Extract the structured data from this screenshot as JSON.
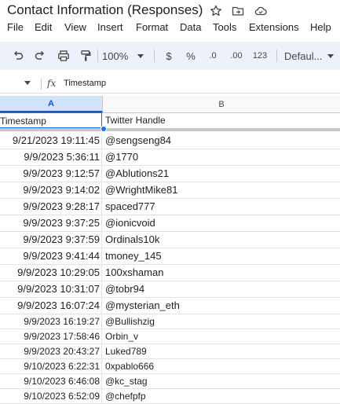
{
  "doc": {
    "title": "Contact Information (Responses)"
  },
  "title_icons": [
    "star-icon",
    "move-to-folder-icon",
    "cloud-saved-icon"
  ],
  "menu": [
    "File",
    "Edit",
    "View",
    "Insert",
    "Format",
    "Data",
    "Tools",
    "Extensions",
    "Help"
  ],
  "toolbar": {
    "zoom": "100%",
    "currency": "$",
    "percent": "%",
    "decrease_decimal": ".0",
    "increase_decimal": ".00",
    "number_format": "123",
    "font": "Defaul..."
  },
  "formula_bar": {
    "fx": "fx",
    "content": "Timestamp"
  },
  "columns": [
    "A",
    "B"
  ],
  "header": {
    "a": "Timestamp",
    "b": "Twitter Handle"
  },
  "rows": [
    {
      "a": "9/21/2023 19:11:45",
      "b": "@sengseng84"
    },
    {
      "a": "9/9/2023 5:36:11",
      "b": "@1770"
    },
    {
      "a": "9/9/2023 9:12:57",
      "b": "@Ablutions21"
    },
    {
      "a": "9/9/2023 9:14:02",
      "b": "@WrightMike81"
    },
    {
      "a": "9/9/2023 9:28:17",
      "b": "spaced777"
    },
    {
      "a": "9/9/2023 9:37:25",
      "b": "@ionicvoid"
    },
    {
      "a": "9/9/2023 9:37:59",
      "b": "Ordinals10k"
    },
    {
      "a": "9/9/2023 9:41:44",
      "b": "tmoney_145"
    },
    {
      "a": "9/9/2023 10:29:05",
      "b": "100xshaman"
    },
    {
      "a": "9/9/2023 10:31:07",
      "b": "@tobr94"
    },
    {
      "a": "9/9/2023 16:07:24",
      "b": "@mysterian_eth"
    },
    {
      "a": "9/9/2023 16:19:27",
      "b": "@Bullishzig"
    },
    {
      "a": "9/9/2023 17:58:46",
      "b": "Orbin_v"
    },
    {
      "a": "9/9/2023 20:43:27",
      "b": "Luked789"
    },
    {
      "a": "9/10/2023 6:22:31",
      "b": "0xpablo666"
    },
    {
      "a": "9/10/2023 6:46:08",
      "b": "@kc_stag"
    },
    {
      "a": "9/10/2023 6:52:09",
      "b": "@chefpfp"
    }
  ]
}
